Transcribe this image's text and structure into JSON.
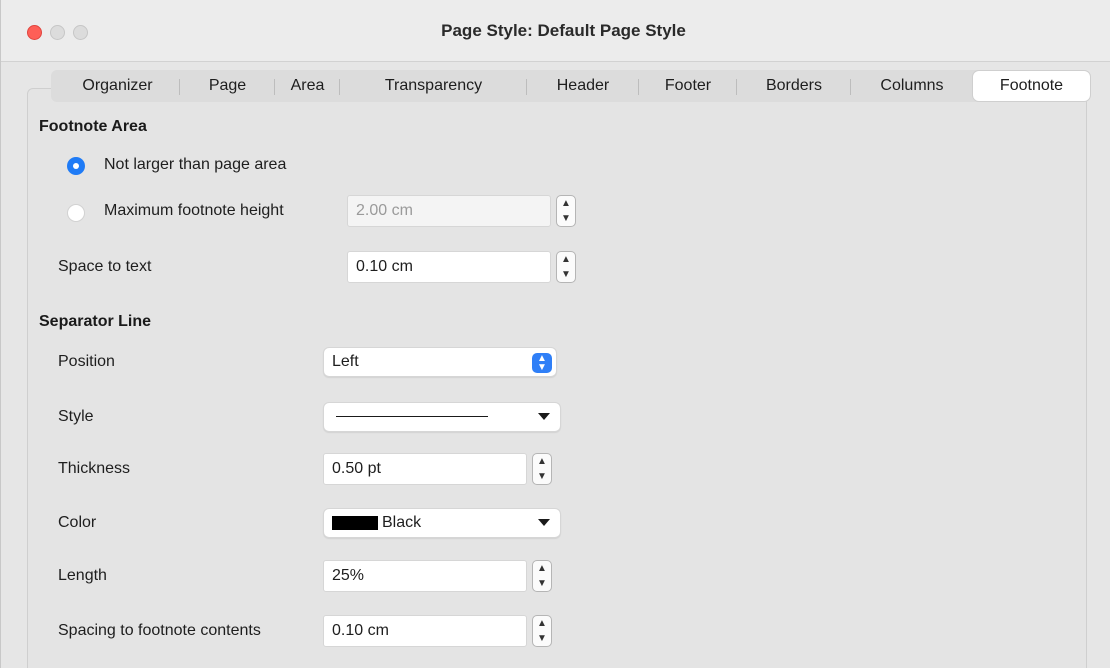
{
  "window": {
    "title": "Page Style: Default Page Style",
    "colors": {
      "close": "#fe5f57",
      "accent": "#1f7bf6"
    }
  },
  "tabs": [
    {
      "label": "Organizer",
      "active": false
    },
    {
      "label": "Page",
      "active": false
    },
    {
      "label": "Area",
      "active": false
    },
    {
      "label": "Transparency",
      "active": false
    },
    {
      "label": "Header",
      "active": false
    },
    {
      "label": "Footer",
      "active": false
    },
    {
      "label": "Borders",
      "active": false
    },
    {
      "label": "Columns",
      "active": false
    },
    {
      "label": "Footnote",
      "active": true
    }
  ],
  "footnote_area": {
    "heading": "Footnote Area",
    "option_not_larger": "Not larger than page area",
    "option_max_height": "Maximum footnote height",
    "max_height_value": "2.00 cm",
    "space_to_text_label": "Space to text",
    "space_to_text_value": "0.10 cm",
    "selected_option": "Not larger than page area"
  },
  "separator_line": {
    "heading": "Separator Line",
    "position_label": "Position",
    "position_value": "Left",
    "style_label": "Style",
    "style_value_icon": "solid-line-sample",
    "thickness_label": "Thickness",
    "thickness_value": "0.50 pt",
    "color_label": "Color",
    "color_value": "Black",
    "color_hex": "#000000",
    "length_label": "Length",
    "length_value": "25%",
    "spacing_label": "Spacing to footnote contents",
    "spacing_value": "0.10 cm"
  },
  "icons": {
    "stepper_up": "▲",
    "stepper_down": "▼",
    "select_arrows": "⇕"
  }
}
